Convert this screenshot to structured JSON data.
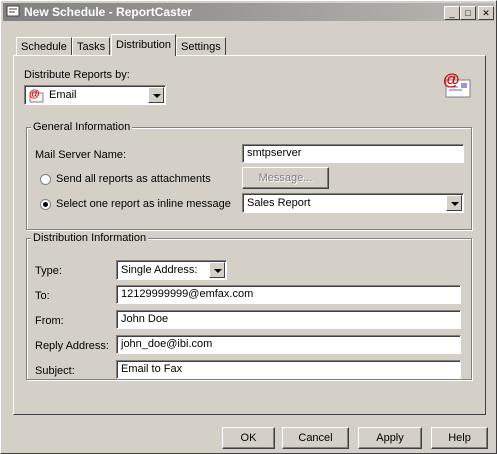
{
  "window": {
    "title": "New Schedule - ReportCaster"
  },
  "tabs": [
    {
      "label": "Schedule"
    },
    {
      "label": "Tasks"
    },
    {
      "label": "Distribution"
    },
    {
      "label": "Settings"
    }
  ],
  "distribute": {
    "label": "Distribute Reports by:",
    "method": "Email"
  },
  "general": {
    "title": "General Information",
    "mail_server_label": "Mail Server Name:",
    "mail_server_value": "smtpserver",
    "opt_attachments": "Send all reports as attachments",
    "message_button": "Message...",
    "opt_inline": "Select one report as inline message",
    "inline_report": "Sales Report"
  },
  "distribution": {
    "title": "Distribution Information",
    "type_label": "Type:",
    "type_value": "Single Address:",
    "to_label": "To:",
    "to_value": "12129999999@emfax.com",
    "from_label": "From:",
    "from_value": "John Doe",
    "reply_label": "Reply Address:",
    "reply_value": "john_doe@ibi.com",
    "subject_label": "Subject:",
    "subject_value": "Email to Fax"
  },
  "buttons": {
    "ok": "OK",
    "cancel": "Cancel",
    "apply": "Apply",
    "help": "Help"
  },
  "icons": [
    "app-icon",
    "minimize-icon",
    "maximize-icon",
    "close-icon",
    "email-icon",
    "email-envelope-icon",
    "chevron-down-icon"
  ],
  "colors": {
    "title_bar": "#808080",
    "face": "#d4d0c8",
    "email_icon_red": "#cc0000"
  }
}
